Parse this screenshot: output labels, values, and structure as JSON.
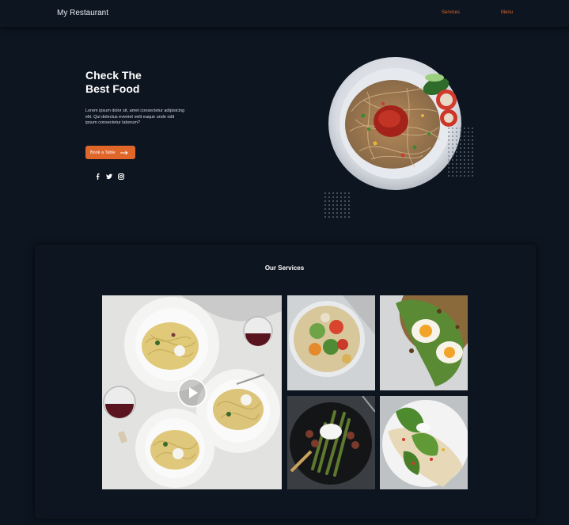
{
  "nav": {
    "brand": "My Restaurant",
    "links": [
      {
        "label": "Services"
      },
      {
        "label": "Menu"
      }
    ]
  },
  "hero": {
    "title_line1": "Check The",
    "title_line2": "Best Food",
    "description": "Lorem ipsum dolor sit, amet consectetur adipisicing elit. Qui delectus eveniet velit eaque unde odit ipsum consectetur laborum?",
    "button_label": "Book a Table",
    "socials": [
      "facebook-icon",
      "twitter-icon",
      "instagram-icon"
    ]
  },
  "services": {
    "title": "Our Services"
  },
  "colors": {
    "background": "#0d1520",
    "accent": "#e0662a"
  }
}
